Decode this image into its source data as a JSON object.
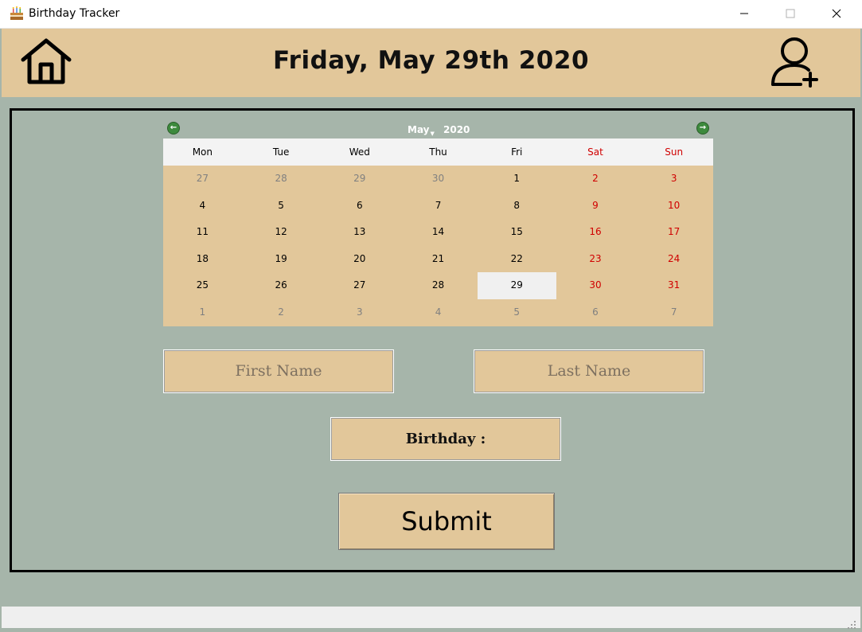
{
  "window": {
    "title": "Birthday Tracker",
    "app_icon": "birthday-cake-icon",
    "controls": [
      "minimize-icon",
      "maximize-icon",
      "close-icon"
    ]
  },
  "header": {
    "date_title": "Friday, May 29th 2020",
    "left_icon": "home-icon",
    "right_icon": "add-user-icon"
  },
  "calendar": {
    "month": "May",
    "year": "2020",
    "prev_icon": "arrow-left-circle-icon",
    "next_icon": "arrow-right-circle-icon",
    "weekdays": [
      "Mon",
      "Tue",
      "Wed",
      "Thu",
      "Fri",
      "Sat",
      "Sun"
    ],
    "weeks": [
      [
        "27",
        "28",
        "29",
        "30",
        "1",
        "2",
        "3"
      ],
      [
        "4",
        "5",
        "6",
        "7",
        "8",
        "9",
        "10"
      ],
      [
        "11",
        "12",
        "13",
        "14",
        "15",
        "16",
        "17"
      ],
      [
        "18",
        "19",
        "20",
        "21",
        "22",
        "23",
        "24"
      ],
      [
        "25",
        "26",
        "27",
        "28",
        "29",
        "30",
        "31"
      ],
      [
        "1",
        "2",
        "3",
        "4",
        "5",
        "6",
        "7"
      ]
    ],
    "selected_day": "29",
    "weekend_color": "#d00000",
    "other_month_color": "#808080"
  },
  "form": {
    "first_name_placeholder": "First Name",
    "last_name_placeholder": "Last Name",
    "birthday_label": "Birthday :",
    "submit_label": "Submit"
  },
  "colors": {
    "background": "#a6b5aa",
    "accent": "#e2c79a",
    "frame_border": "#000000"
  }
}
